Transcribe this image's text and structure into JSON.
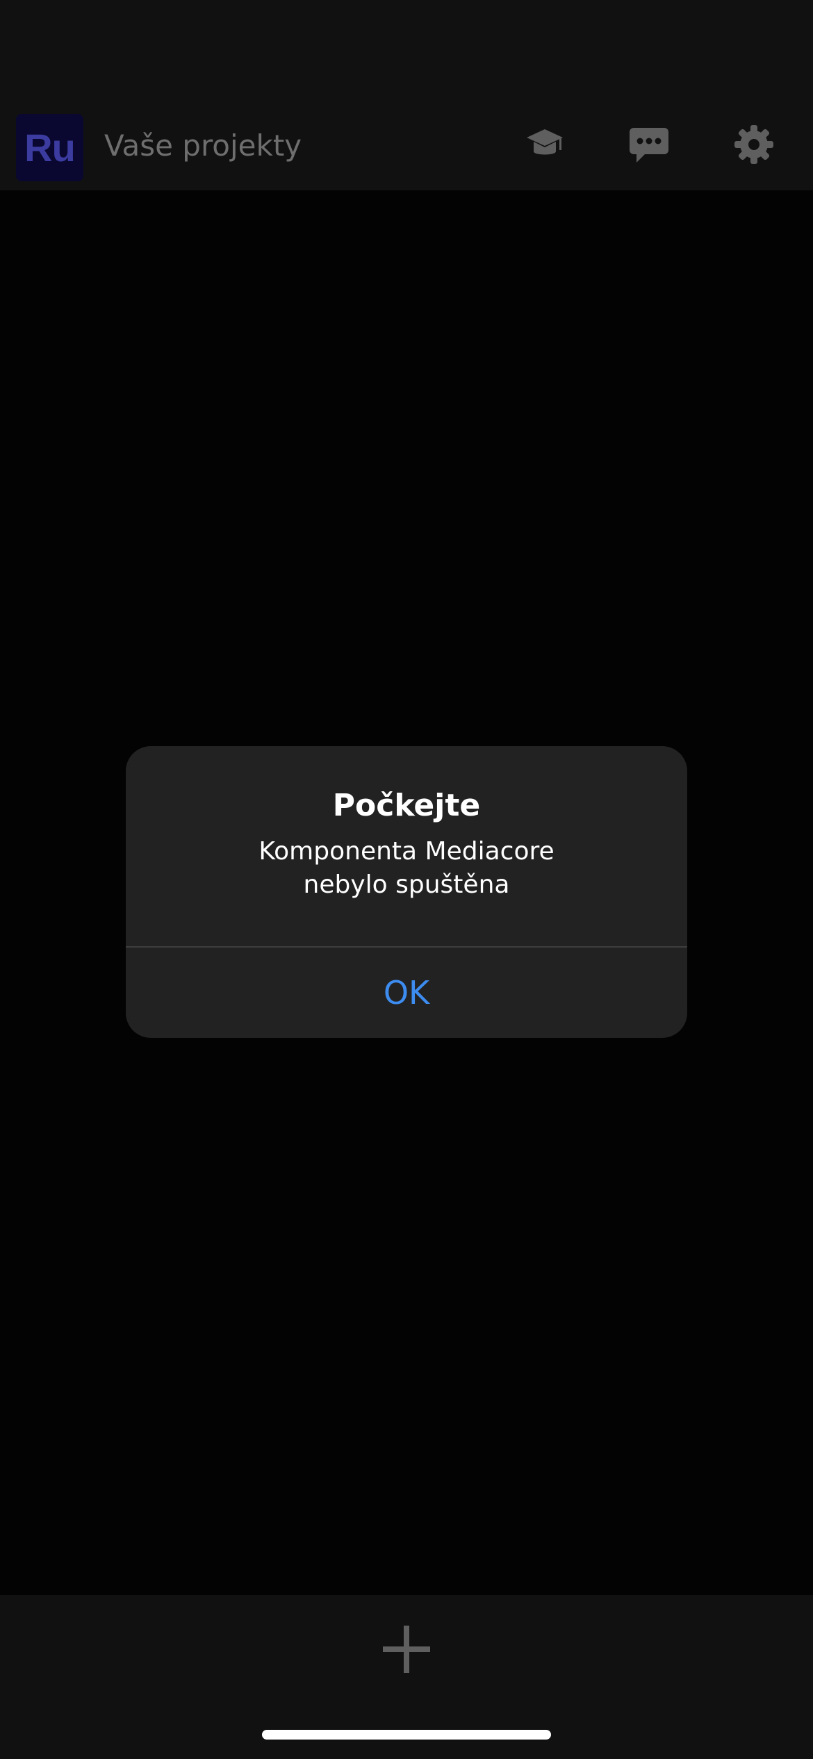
{
  "header": {
    "logo_text": "Ru",
    "title": "Vaše projekty",
    "icons": [
      "tutorial-icon",
      "feedback-icon",
      "settings-icon"
    ]
  },
  "dialog": {
    "title": "Počkejte",
    "message_line1": "Komponenta Mediacore",
    "message_line2": "nebylo spuštěna",
    "ok_label": "OK"
  },
  "bottom_bar": {
    "add_icon": "plus-icon"
  },
  "colors": {
    "background": "#030303",
    "bar_background": "#111111",
    "dialog_background": "#222222",
    "accent_blue": "#3d8cf0",
    "icon_gray": "#5f5f5f",
    "logo_background": "#0a0830",
    "logo_text": "#3b3ba0"
  }
}
